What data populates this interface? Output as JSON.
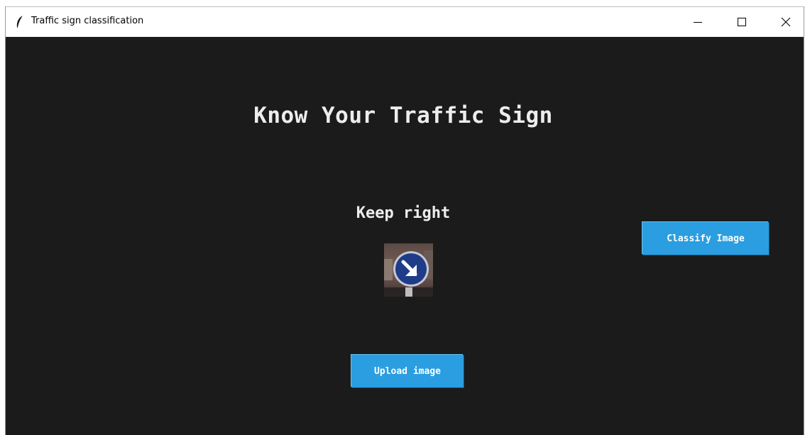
{
  "window": {
    "title": "Traffic sign classification",
    "controls": {
      "minimize_icon": "minimize-icon",
      "maximize_icon": "maximize-icon",
      "close_icon": "close-icon"
    },
    "app_icon": "feather-icon"
  },
  "main": {
    "heading": "Know Your Traffic Sign",
    "prediction": "Keep right",
    "image_icon": "keep-right-sign-image",
    "classify_button": "Classify Image",
    "upload_button": "Upload image"
  },
  "colors": {
    "background": "#1b1b1b",
    "text": "#ededed",
    "button": "#2a9ee0",
    "button_text": "#ffffff"
  }
}
